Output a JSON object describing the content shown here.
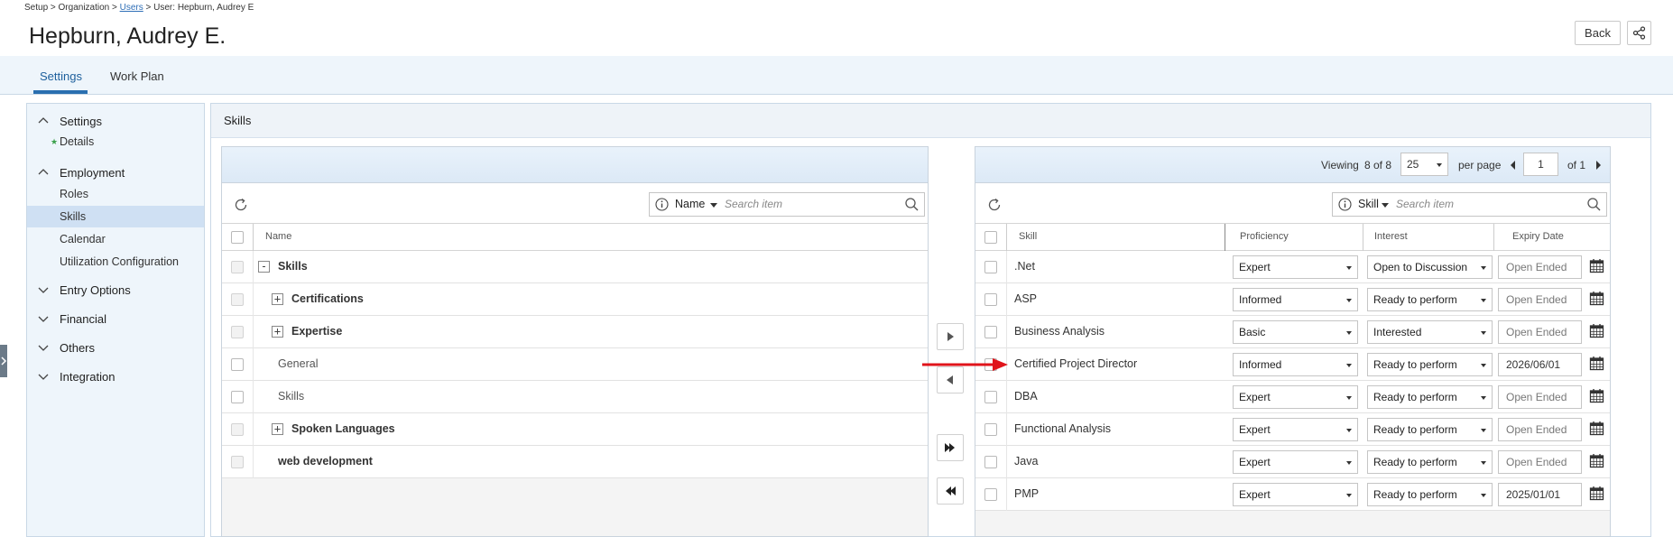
{
  "breadcrumb": {
    "part1": "Setup > Organization > ",
    "link": "Users",
    "part2": " > User: Hepburn, Audrey E"
  },
  "page_title": "Hepburn, Audrey E.",
  "header": {
    "back_label": "Back",
    "share_icon": "share-icon"
  },
  "tabs": [
    {
      "label": "Settings",
      "active": true
    },
    {
      "label": "Work Plan",
      "active": false
    }
  ],
  "sidebar": {
    "settings": {
      "label": "Settings",
      "items": [
        {
          "label": "Details"
        }
      ]
    },
    "employment": {
      "label": "Employment",
      "items": [
        {
          "label": "Roles"
        },
        {
          "label": "Skills",
          "active": true
        },
        {
          "label": "Calendar"
        },
        {
          "label": "Utilization Configuration"
        }
      ]
    },
    "collapsed": [
      {
        "label": "Entry Options"
      },
      {
        "label": "Financial"
      },
      {
        "label": "Others"
      },
      {
        "label": "Integration"
      }
    ]
  },
  "main": {
    "title": "Skills"
  },
  "left_grid": {
    "search": {
      "field": "Name",
      "placeholder": "Search item"
    },
    "columns": {
      "name": "Name"
    },
    "rows": [
      {
        "label": "Skills",
        "level": 0,
        "expander": "-",
        "bold": true
      },
      {
        "label": "Certifications",
        "level": 1,
        "expander": "+",
        "bold": true
      },
      {
        "label": "Expertise",
        "level": 1,
        "expander": "+",
        "bold": true
      },
      {
        "label": "General",
        "level": 1,
        "expander": "",
        "bold": false
      },
      {
        "label": "Skills",
        "level": 1,
        "expander": "",
        "bold": false
      },
      {
        "label": "Spoken Languages",
        "level": 1,
        "expander": "+",
        "bold": true
      },
      {
        "label": "web development",
        "level": 1,
        "expander": "",
        "bold": true
      }
    ]
  },
  "right_grid": {
    "pager": {
      "viewing_label": "Viewing",
      "viewing_value": "8 of 8",
      "per_page_value": "25",
      "per_page_label": "per page",
      "page_value": "1",
      "of_label": "of 1"
    },
    "search": {
      "field": "Skill",
      "placeholder": "Search item"
    },
    "columns": {
      "skill": "Skill",
      "proficiency": "Proficiency",
      "interest": "Interest",
      "expiry": "Expiry Date"
    },
    "rows": [
      {
        "skill": ".Net",
        "proficiency": "Expert",
        "interest": "Open to Discussion",
        "expiry": "Open Ended"
      },
      {
        "skill": "ASP",
        "proficiency": "Informed",
        "interest": "Ready to perform",
        "expiry": "Open Ended"
      },
      {
        "skill": "Business Analysis",
        "proficiency": "Basic",
        "interest": "Interested",
        "expiry": "Open Ended"
      },
      {
        "skill": "Certified Project Director",
        "proficiency": "Informed",
        "interest": "Ready to perform",
        "expiry": "2026/06/01"
      },
      {
        "skill": "DBA",
        "proficiency": "Expert",
        "interest": "Ready to perform",
        "expiry": "Open Ended"
      },
      {
        "skill": "Functional Analysis",
        "proficiency": "Expert",
        "interest": "Ready to perform",
        "expiry": "Open Ended"
      },
      {
        "skill": "Java",
        "proficiency": "Expert",
        "interest": "Ready to perform",
        "expiry": "Open Ended"
      },
      {
        "skill": "PMP",
        "proficiency": "Expert",
        "interest": "Ready to perform",
        "expiry": "2025/01/01"
      }
    ]
  },
  "colors": {
    "accent": "#2a6fb0",
    "annotation_arrow": "#e0141b",
    "panel_bg": "#eef5fb",
    "selected_bg": "#cfe0f3"
  }
}
